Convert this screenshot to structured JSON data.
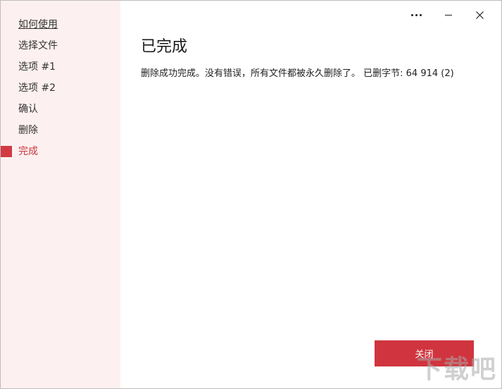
{
  "sidebar": {
    "items": [
      {
        "label": "如何使用"
      },
      {
        "label": "选择文件"
      },
      {
        "label": "选项 #1"
      },
      {
        "label": "选项 #2"
      },
      {
        "label": "确认"
      },
      {
        "label": "删除"
      },
      {
        "label": "完成"
      }
    ],
    "active_index": 6
  },
  "main": {
    "title": "已完成",
    "message": "删除成功完成。没有错误，所有文件都被永久删除了。 已删字节: 64 914 (2)"
  },
  "footer": {
    "button_label": "关闭"
  },
  "watermark": "下载吧",
  "colors": {
    "accent": "#d0353f",
    "sidebar_bg": "#fdf0f0"
  }
}
